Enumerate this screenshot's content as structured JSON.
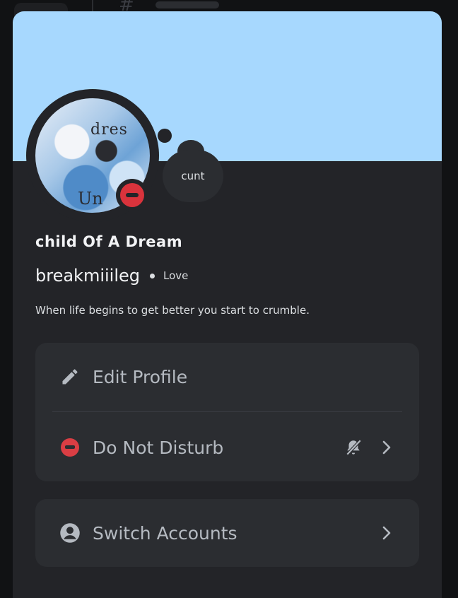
{
  "profile": {
    "display_name": "child Of A Dream",
    "username": "breakmiiileg",
    "pronouns": "Love",
    "bio": "When life begins to get better you start to crumble.",
    "custom_status": "cunt",
    "avatar_text_top": "dres",
    "avatar_text_bottom": "Un",
    "status": "do-not-disturb"
  },
  "colors": {
    "banner": "#a7d8fe",
    "panel": "#232428",
    "card": "#2b2d31",
    "dnd": "#d9333c"
  },
  "menu": {
    "edit_profile": {
      "label": "Edit Profile",
      "icon": "pencil-icon"
    },
    "status": {
      "label": "Do Not Disturb",
      "icon": "dnd-icon",
      "secondary_icon": "bell-muted-icon"
    },
    "switch_accounts": {
      "label": "Switch Accounts",
      "icon": "account-circle-icon"
    }
  }
}
